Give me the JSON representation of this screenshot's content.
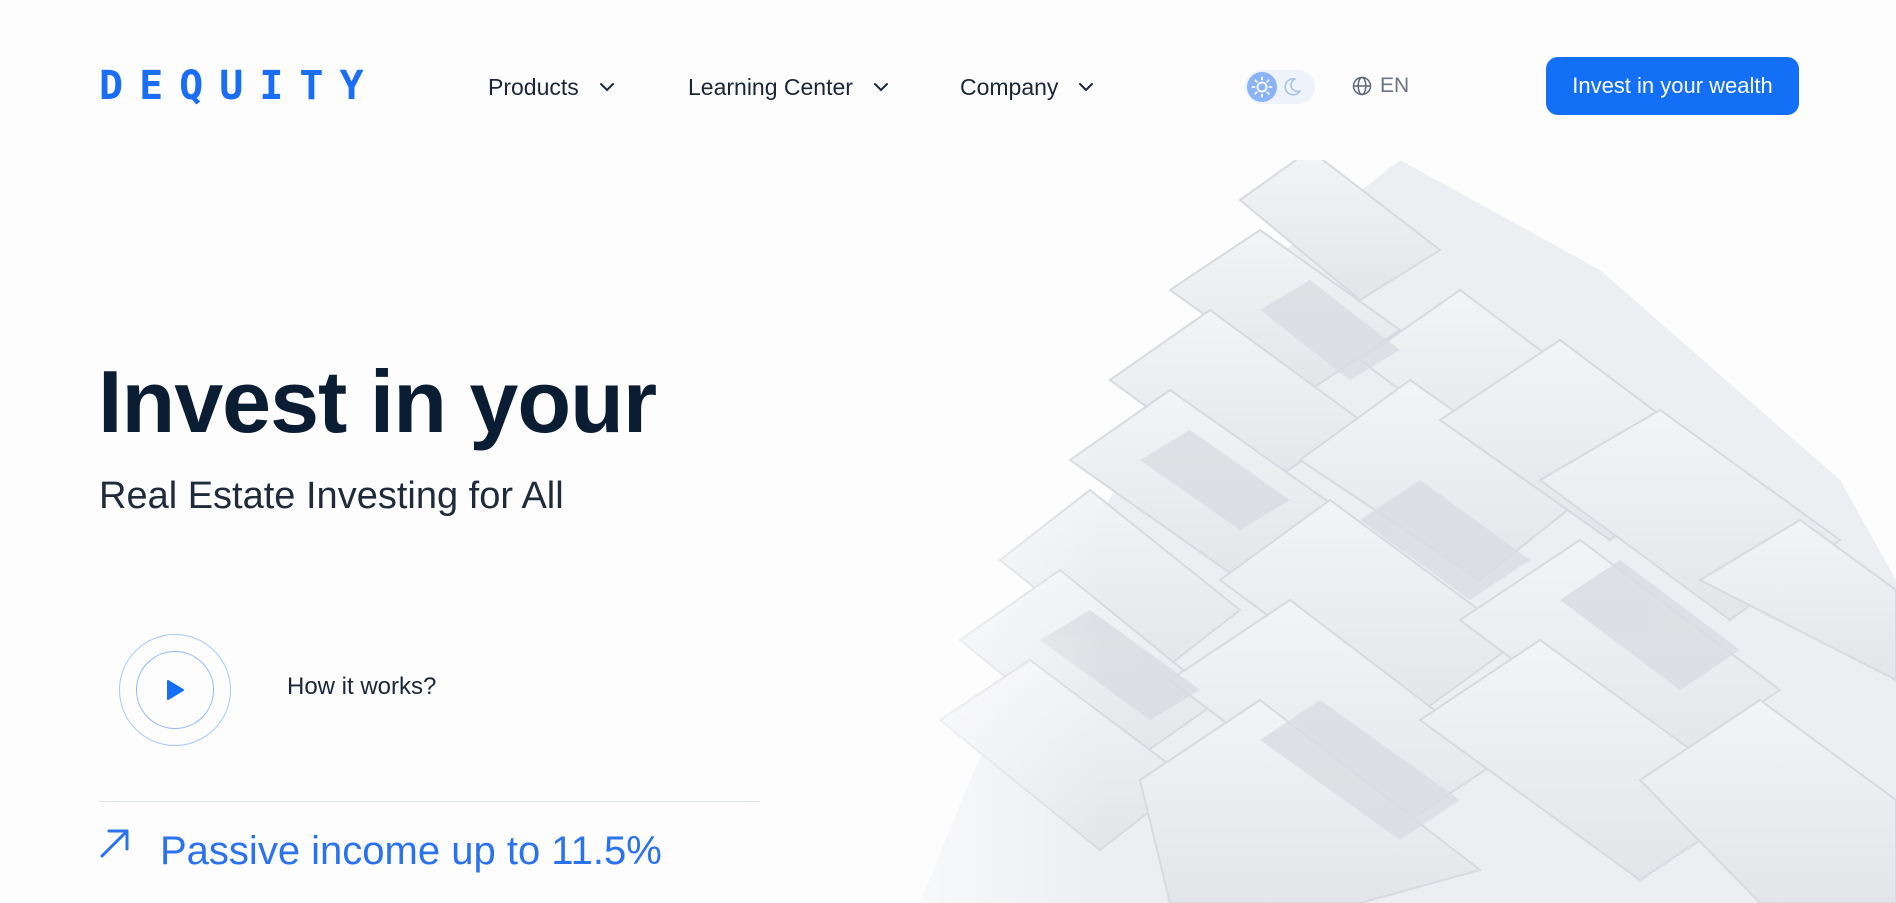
{
  "brand": {
    "logo_text": "DEQUITY",
    "accent": "#136ff6"
  },
  "nav": {
    "items": [
      {
        "label": "Products",
        "icon": "chevron-down-icon"
      },
      {
        "label": "Learning Center",
        "icon": "chevron-down-icon"
      },
      {
        "label": "Company",
        "icon": "chevron-down-icon"
      }
    ]
  },
  "theme_toggle": {
    "light_icon": "sun-icon",
    "dark_icon": "moon-icon",
    "active": "light"
  },
  "language": {
    "icon": "globe-icon",
    "label": "EN"
  },
  "header_cta": {
    "label": "Invest in your wealth"
  },
  "hero": {
    "title": "Invest in your",
    "subtitle": "Real Estate Investing for All",
    "video": {
      "icon": "play-icon",
      "label": "How it works?"
    },
    "highlight": {
      "icon": "arrow-up-right-icon",
      "text": "Passive income up to 11.5%"
    }
  }
}
